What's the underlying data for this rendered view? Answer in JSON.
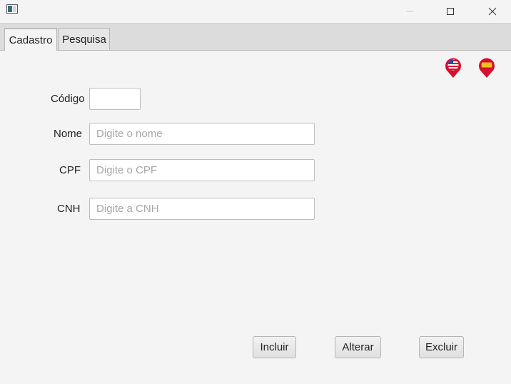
{
  "tabs": [
    {
      "label": "Cadastro",
      "active": true
    },
    {
      "label": "Pesquisa",
      "active": false
    }
  ],
  "language_flags": [
    {
      "icon": "us-flag-pin-icon"
    },
    {
      "icon": "es-flag-pin-icon"
    }
  ],
  "form": {
    "codigo": {
      "label": "Código",
      "value": ""
    },
    "nome": {
      "label": "Nome",
      "placeholder": "Digite o nome",
      "value": ""
    },
    "cpf": {
      "label": "CPF",
      "placeholder": "Digite o CPF",
      "value": ""
    },
    "cnh": {
      "label": "CNH",
      "placeholder": "Digite a CNH",
      "value": ""
    }
  },
  "buttons": {
    "incluir": "Incluir",
    "alterar": "Alterar",
    "excluir": "Excluir"
  },
  "colors": {
    "pin_red": "#d6102e",
    "us_blue": "#2a4aa8",
    "es_yellow": "#f4c020"
  }
}
